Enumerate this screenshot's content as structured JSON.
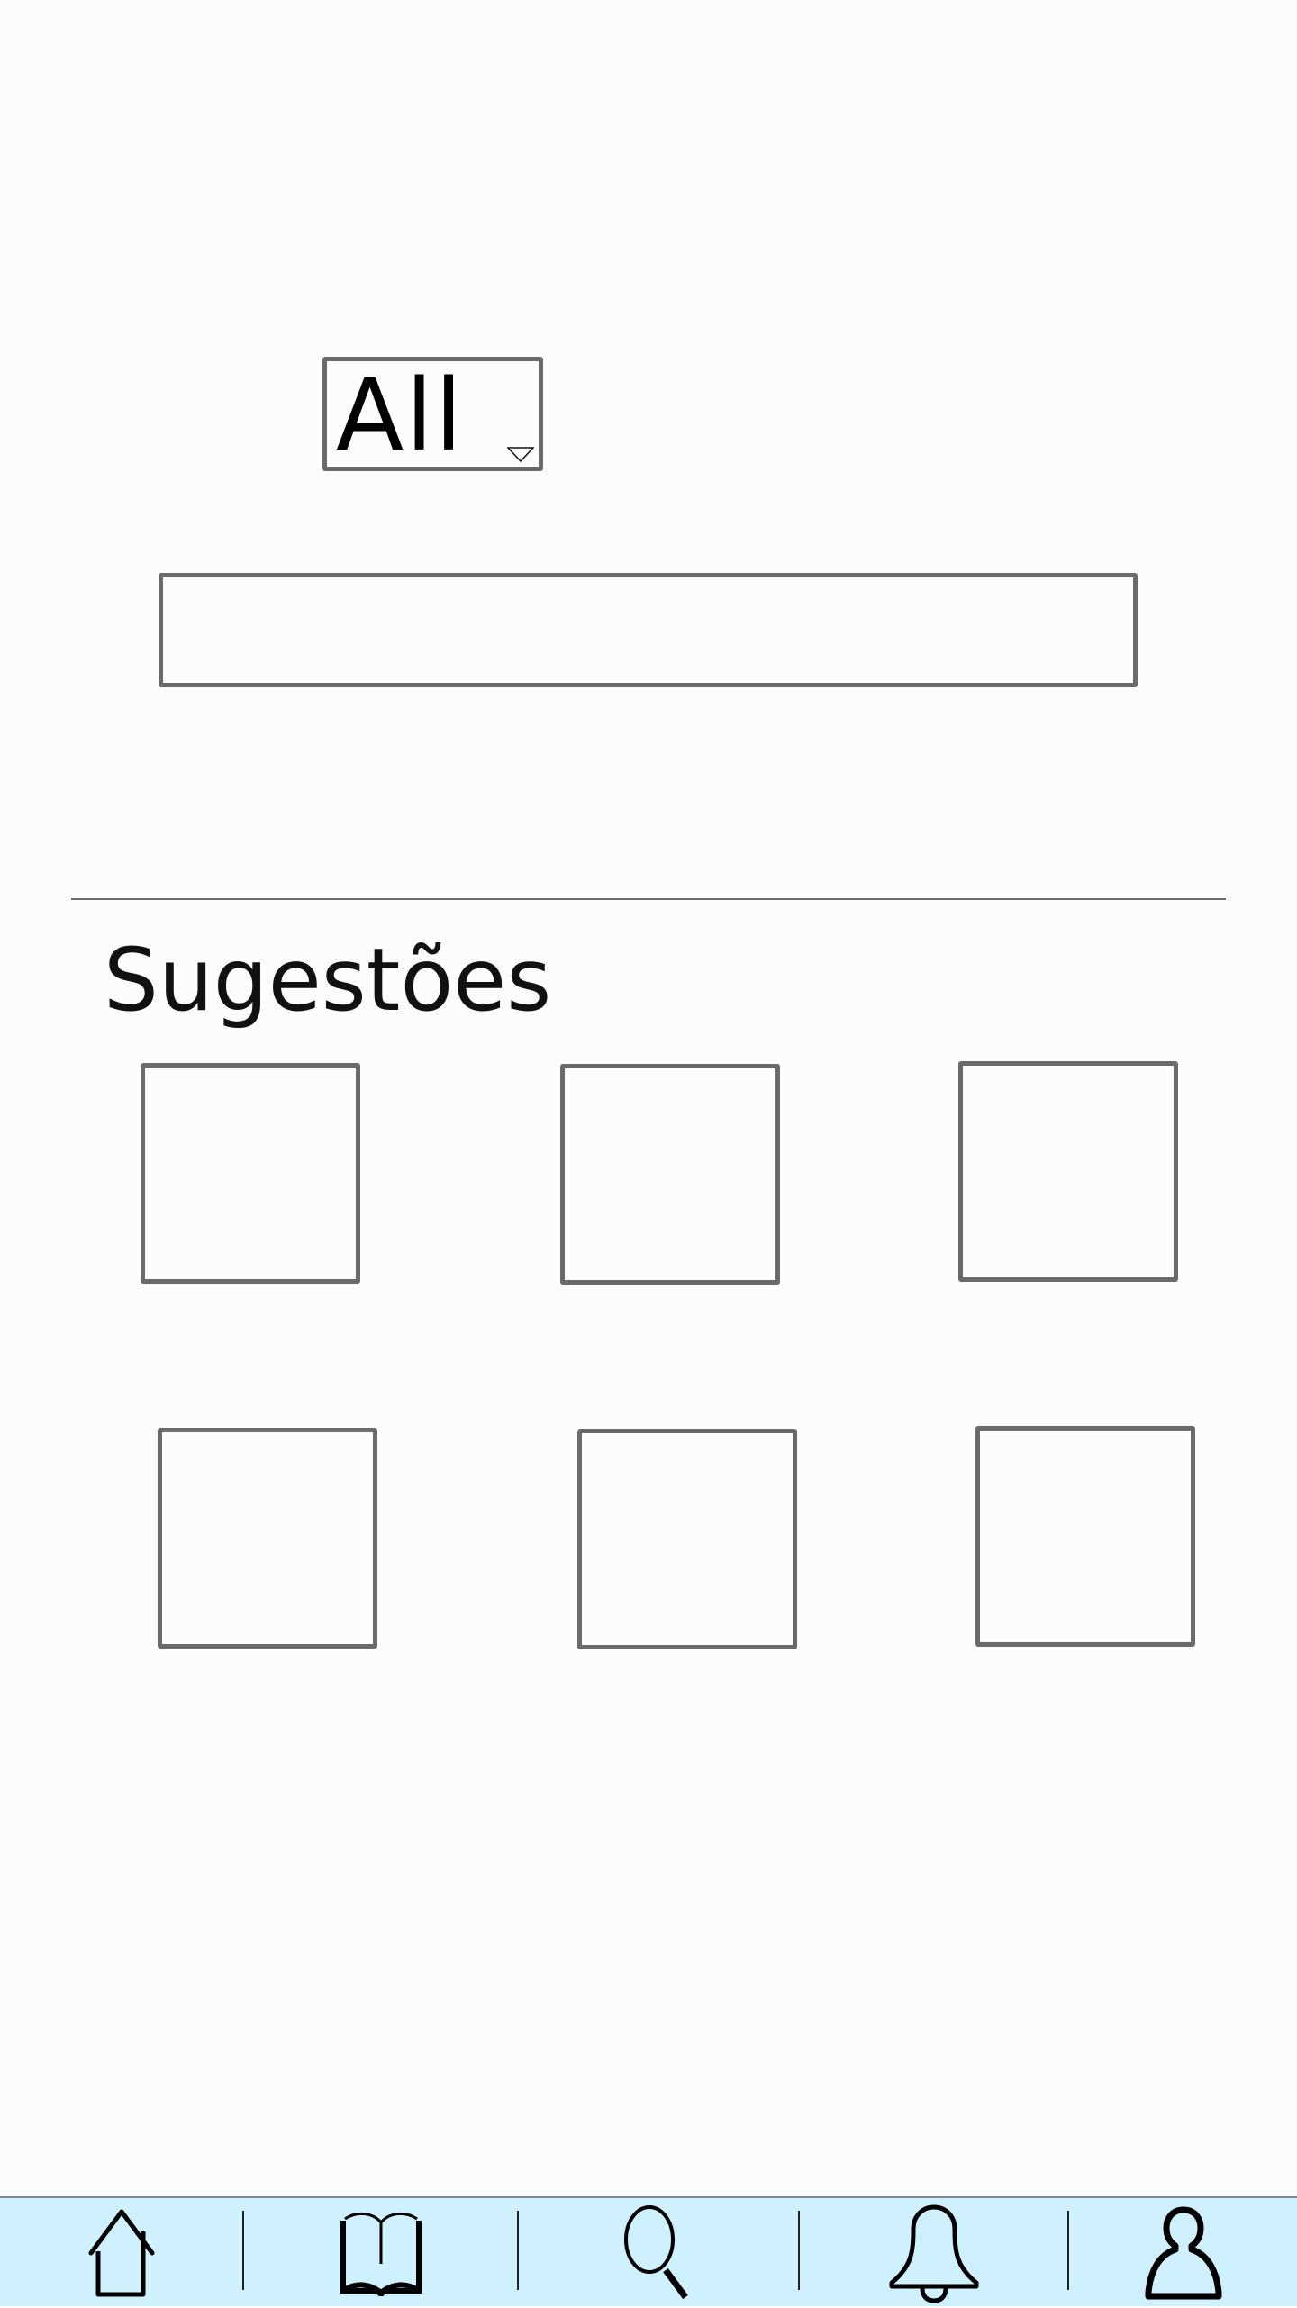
{
  "filter": {
    "selected": "All",
    "arrow_icon": "triangle-down-icon"
  },
  "search": {
    "value": "",
    "placeholder": ""
  },
  "suggestions": {
    "title": "Sugestões",
    "tile_count": 6
  },
  "bottom_nav": {
    "background": "#cff1fd",
    "items": [
      {
        "icon": "home-icon"
      },
      {
        "icon": "book-icon"
      },
      {
        "icon": "search-icon"
      },
      {
        "icon": "bell-icon"
      },
      {
        "icon": "profile-icon"
      }
    ]
  }
}
